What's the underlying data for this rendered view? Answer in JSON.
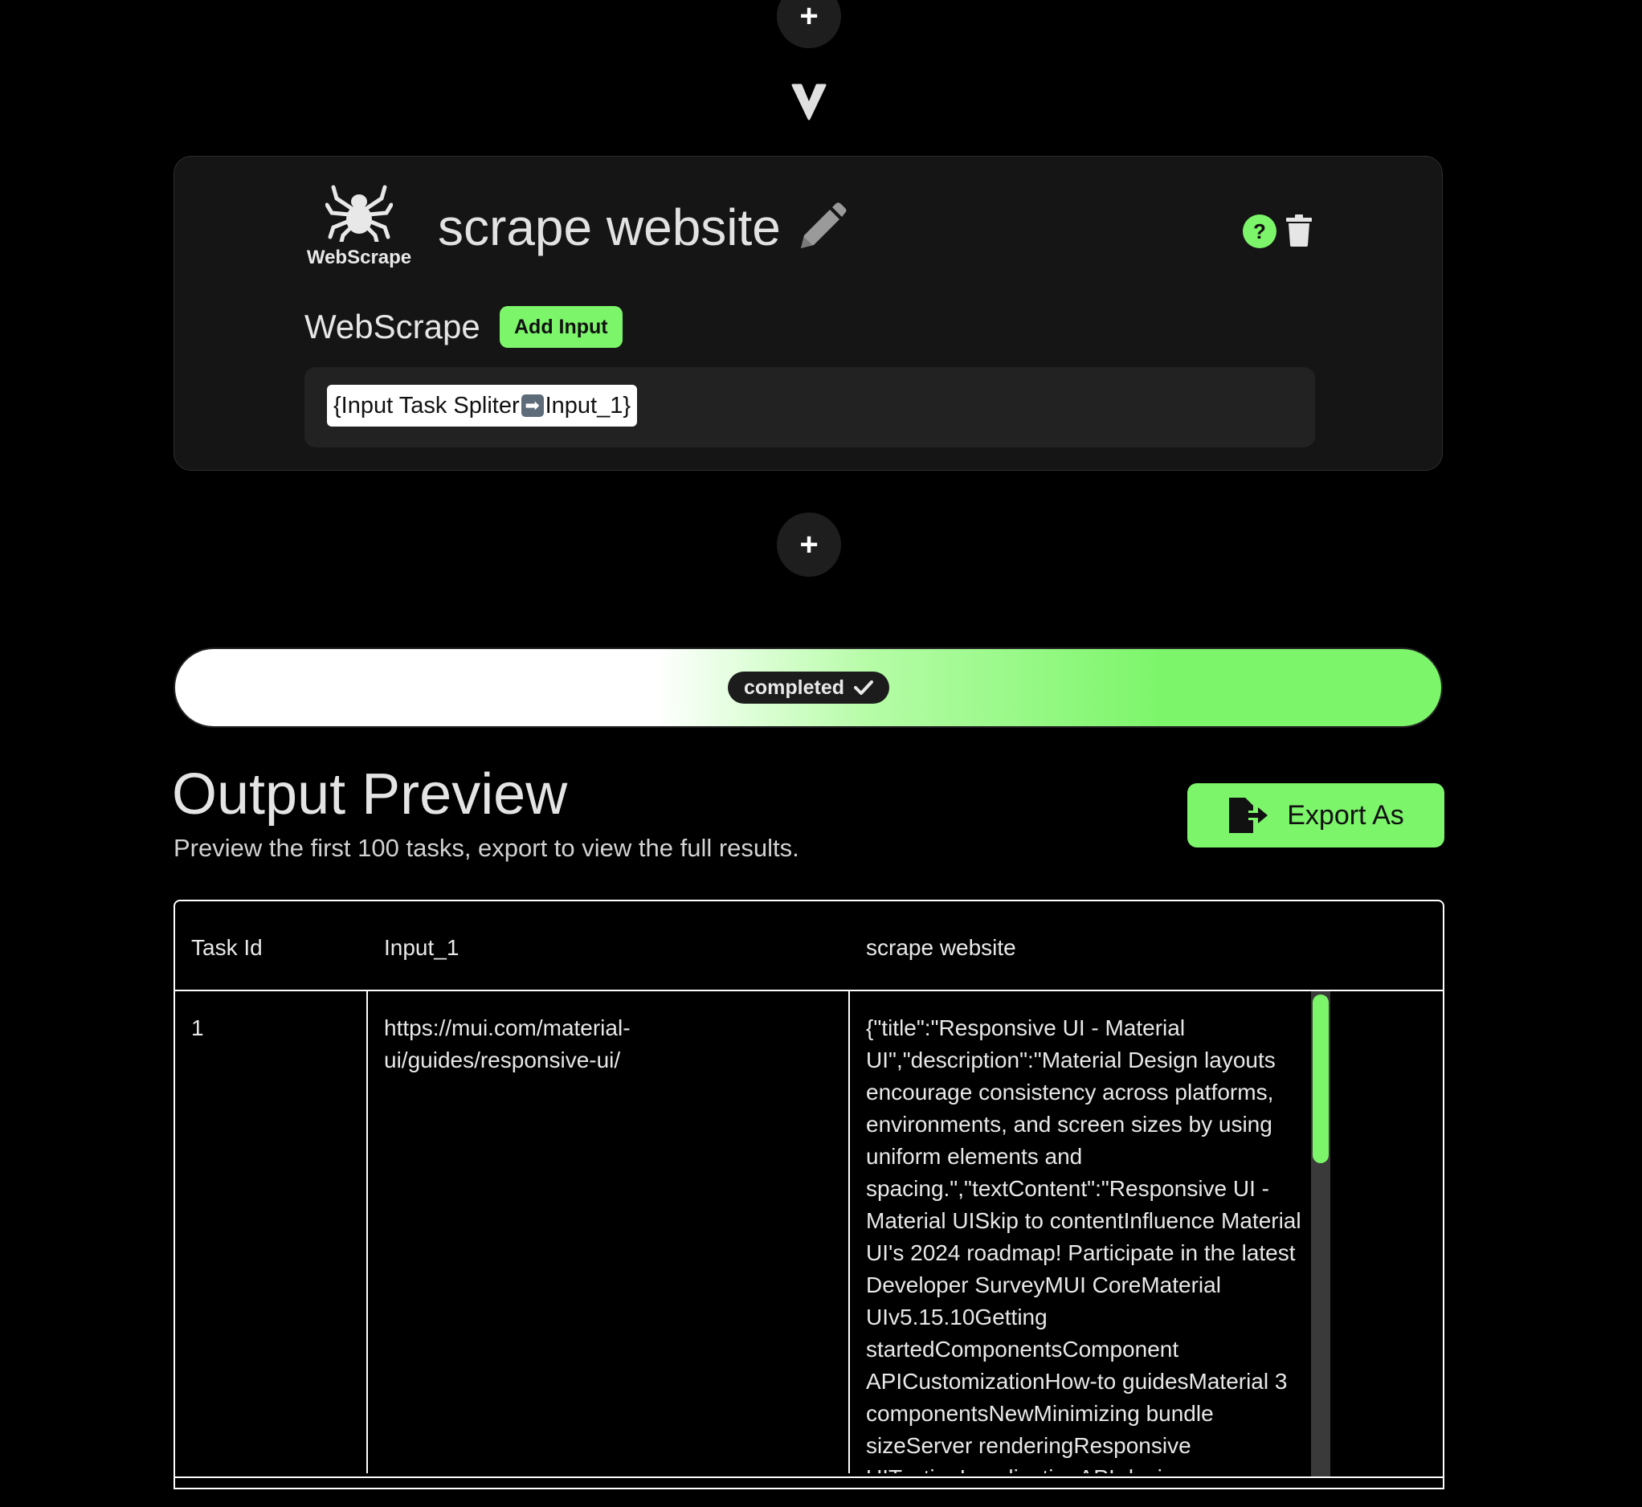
{
  "colors": {
    "accent": "#7cf56a",
    "background": "#000000",
    "card": "#151515"
  },
  "flow": {
    "add_step_symbol": "+",
    "connector_icon": "chevron-down-icon"
  },
  "task_card": {
    "tool_icon": "spider-icon",
    "tool_name": "WebScrape",
    "title": "scrape website",
    "edit_icon": "pencil-icon",
    "help_symbol": "?",
    "delete_icon": "trash-icon",
    "input_label": "WebScrape",
    "add_input_label": "Add Input",
    "input_chip": {
      "prefix": "{Input Task Spliter",
      "arrow": "➡",
      "suffix": " Input_1}"
    }
  },
  "status": {
    "label": "completed",
    "icon": "check-icon",
    "progress_percent": 100
  },
  "output_preview": {
    "title": "Output Preview",
    "subtitle": "Preview the first 100 tasks, export to view the full results.",
    "export_label": "Export As",
    "export_icon": "file-export-icon",
    "table": {
      "headers": [
        "Task Id",
        "Input_1",
        "scrape website"
      ],
      "rows": [
        {
          "task_id": "1",
          "input_1": "https://mui.com/material-ui/guides/responsive-ui/",
          "output": "{\"title\":\"Responsive UI - Material UI\",\"description\":\"Material Design layouts encourage consistency across platforms, environments, and screen sizes by using uniform elements and spacing.\",\"textContent\":\"Responsive UI - Material UISkip to contentInfluence Material UI's 2024 roadmap! Participate in the latest Developer SurveyMUI CoreMaterial UIv5.15.10Getting startedComponentsComponent APICustomizationHow-to guidesMaterial 3 componentsNewMinimizing bundle sizeServer renderingResponsive UITestingLocalizationAPI design"
        }
      ]
    }
  }
}
